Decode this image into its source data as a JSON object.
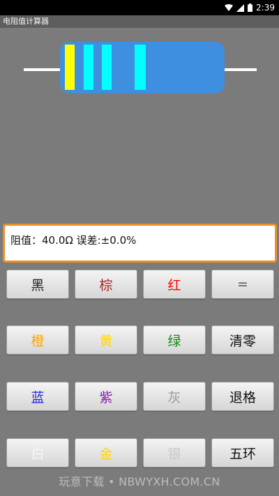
{
  "status_bar": {
    "time": "2:39",
    "icons": [
      "wifi-icon",
      "signal-icon",
      "battery-icon"
    ]
  },
  "app": {
    "title": "电阻值计算器"
  },
  "resistor": {
    "lead_color": "#ffffff",
    "body_color": "#3f8fe0",
    "bands": [
      {
        "color_name": "黄",
        "hex": "#ffff00"
      },
      {
        "color_name": "cyan",
        "hex": "#00ffff"
      },
      {
        "color_name": "cyan",
        "hex": "#00ffff"
      },
      {
        "color_name": "cyan",
        "hex": "#00ffff"
      }
    ]
  },
  "result": {
    "text": "阻值：40.0Ω 误差:±0.0%"
  },
  "buttons": [
    {
      "label": "黑",
      "color": "#222222"
    },
    {
      "label": "棕",
      "color": "#a52a2a"
    },
    {
      "label": "红",
      "color": "#ff0000"
    },
    {
      "label": "=",
      "color": "#555555"
    },
    {
      "label": "橙",
      "color": "#ffa500"
    },
    {
      "label": "黄",
      "color": "#ffd800"
    },
    {
      "label": "绿",
      "color": "#0f8f0f"
    },
    {
      "label": "清零",
      "color": "#111111"
    },
    {
      "label": "蓝",
      "color": "#2222dd"
    },
    {
      "label": "紫",
      "color": "#8a1fb0"
    },
    {
      "label": "灰",
      "color": "#9a9a9a"
    },
    {
      "label": "退格",
      "color": "#111111"
    },
    {
      "label": "白",
      "color": "#f6f6f6"
    },
    {
      "label": "金",
      "color": "#ffd700"
    },
    {
      "label": "银",
      "color": "#c8c8c8"
    },
    {
      "label": "五环",
      "color": "#111111"
    }
  ],
  "watermark": "玩意下载 • NBWYXH.COM.CN"
}
